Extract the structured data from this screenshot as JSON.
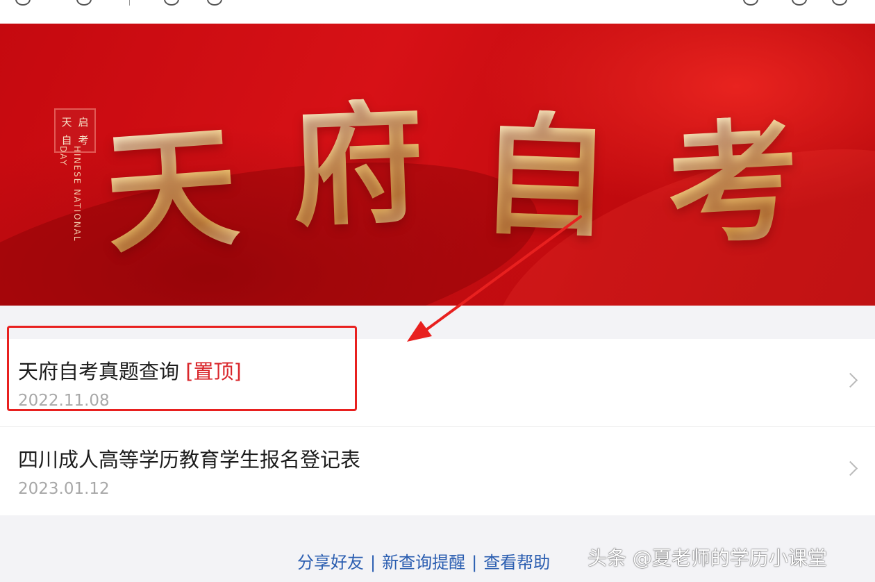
{
  "banner": {
    "title_chars": [
      "天",
      "府",
      "自",
      "考"
    ],
    "seal_chars": [
      "天",
      "启",
      "自",
      "考"
    ],
    "vertical_text": [
      "DAY",
      "HINESE NATIONAL"
    ]
  },
  "list": {
    "items": [
      {
        "title": "天府自考真题查询 ",
        "pin": "[置顶]",
        "date": "2022.11.08"
      },
      {
        "title": "四川成人高等学历教育学生报名登记表",
        "pin": "",
        "date": "2023.01.12"
      }
    ]
  },
  "footer": {
    "links": [
      "分享好友",
      "新查询提醒",
      "查看帮助"
    ],
    "separator": "|",
    "watermark": "头条 @夏老师的学历小课堂"
  },
  "colors": {
    "banner_red": "#d71116",
    "gold": "#f1c878",
    "pin_red": "#d9262b",
    "annotation_red": "#e8201f",
    "link_blue": "#2a5db0"
  }
}
